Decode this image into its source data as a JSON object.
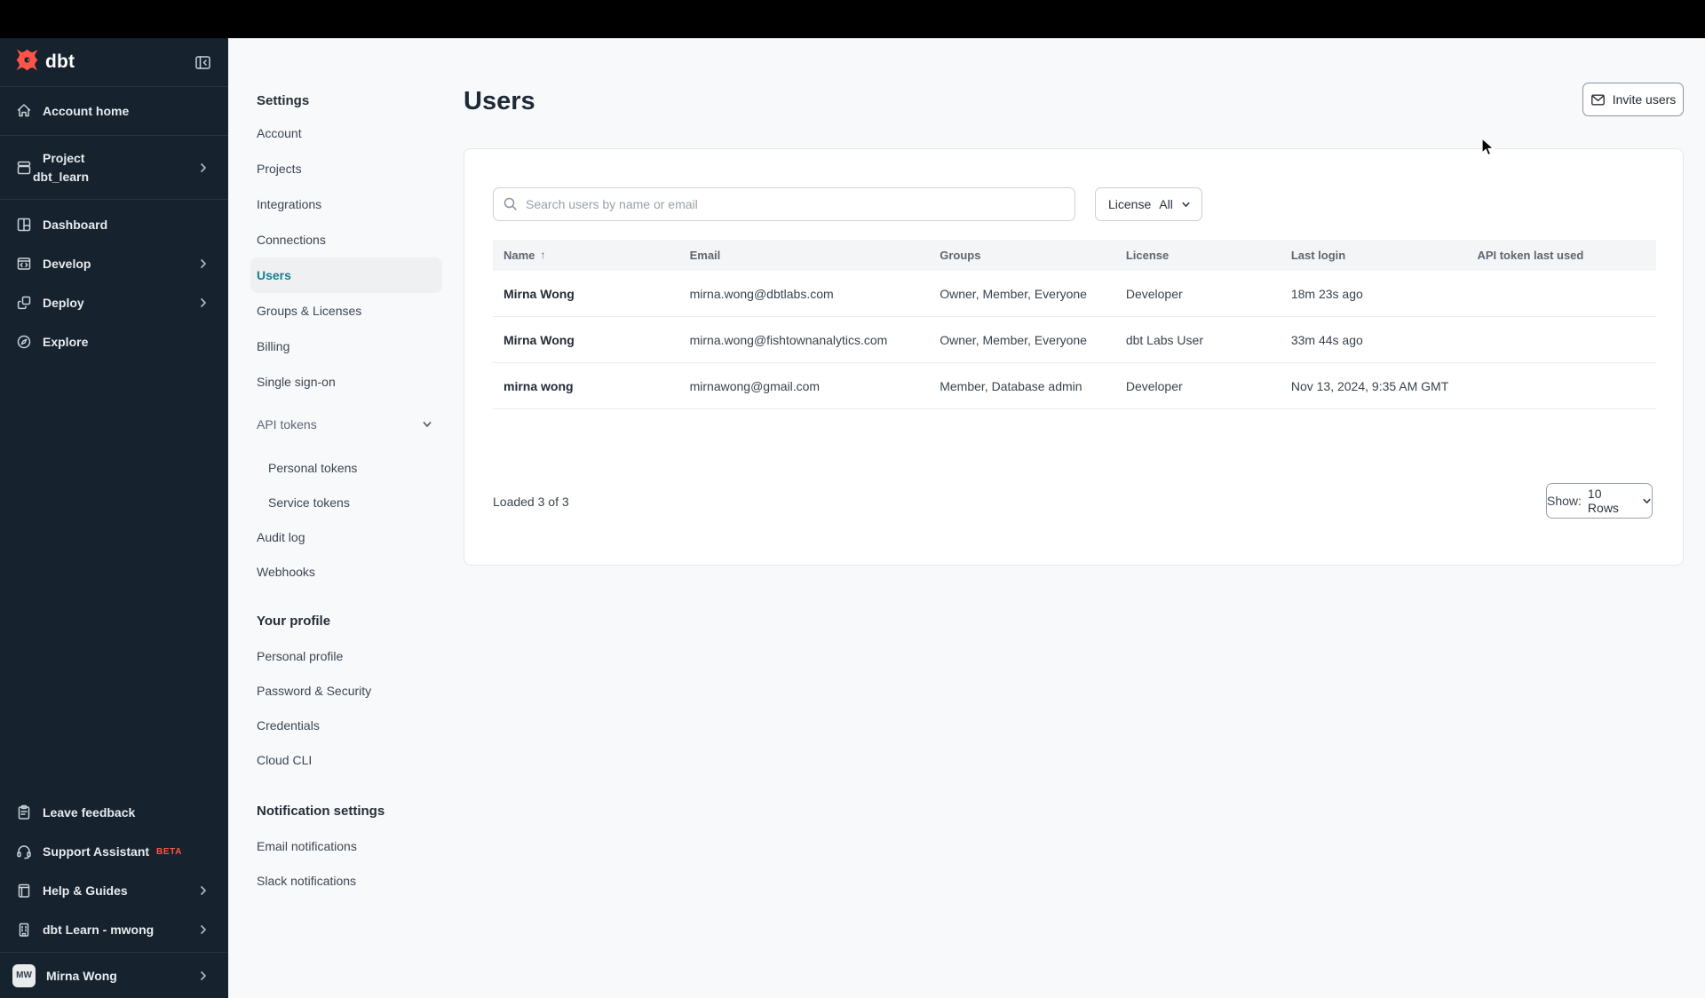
{
  "sidebar": {
    "logo_text": "dbt",
    "items": [
      {
        "label": "Account home"
      },
      {
        "label": "Project",
        "sublabel": "dbt_learn"
      },
      {
        "label": "Dashboard"
      },
      {
        "label": "Develop"
      },
      {
        "label": "Deploy"
      },
      {
        "label": "Explore"
      }
    ],
    "footer_items": [
      {
        "label": "Leave feedback"
      },
      {
        "label": "Support Assistant",
        "badge": "BETA"
      },
      {
        "label": "Help & Guides"
      },
      {
        "label": "dbt Learn - mwong"
      }
    ],
    "user": {
      "initials": "MW",
      "name": "Mirna Wong"
    }
  },
  "settings_nav": {
    "title": "Settings",
    "items": [
      {
        "label": "Account"
      },
      {
        "label": "Projects"
      },
      {
        "label": "Integrations"
      },
      {
        "label": "Connections"
      },
      {
        "label": "Users"
      },
      {
        "label": "Groups & Licenses"
      },
      {
        "label": "Billing"
      },
      {
        "label": "Single sign-on"
      },
      {
        "label": "API tokens"
      }
    ],
    "token_children": [
      {
        "label": "Personal tokens"
      },
      {
        "label": "Service tokens"
      }
    ],
    "tail_items": [
      {
        "label": "Audit log"
      },
      {
        "label": "Webhooks"
      }
    ],
    "profile_title": "Your profile",
    "profile_items": [
      {
        "label": "Personal profile"
      },
      {
        "label": "Password & Security"
      },
      {
        "label": "Credentials"
      },
      {
        "label": "Cloud CLI"
      }
    ],
    "notifications_title": "Notification settings",
    "notification_items": [
      {
        "label": "Email notifications"
      },
      {
        "label": "Slack notifications"
      }
    ]
  },
  "header": {
    "title": "Users",
    "invite_button": "Invite users"
  },
  "toolbar": {
    "search_placeholder": "Search users by name or email",
    "license_label": "License",
    "license_value": "All"
  },
  "table": {
    "columns": [
      {
        "label": "Name",
        "sort": "↑"
      },
      {
        "label": "Email"
      },
      {
        "label": "Groups"
      },
      {
        "label": "License"
      },
      {
        "label": "Last login"
      },
      {
        "label": "API token last used"
      }
    ],
    "rows": [
      {
        "name": "Mirna Wong",
        "email": "mirna.wong@dbtlabs.com",
        "groups": "Owner, Member, Everyone",
        "license": "Developer",
        "last_login": "18m 23s ago",
        "api_token": ""
      },
      {
        "name": "Mirna Wong",
        "email": "mirna.wong@fishtownanalytics.com",
        "groups": "Owner, Member, Everyone",
        "license": "dbt Labs User",
        "last_login": "33m 44s ago",
        "api_token": ""
      },
      {
        "name": "mirna wong",
        "email": "mirnawong@gmail.com",
        "groups": "Member, Database admin",
        "license": "Developer",
        "last_login": "Nov 13, 2024, 9:35 AM GMT",
        "api_token": ""
      }
    ]
  },
  "footer": {
    "loaded": "Loaded 3 of 3",
    "show_label": "Show:",
    "show_value": "10 Rows"
  },
  "colors": {
    "accent_orange": "#ff5447",
    "selected_teal": "#16808f",
    "sidebar_bg": "#16222d"
  }
}
